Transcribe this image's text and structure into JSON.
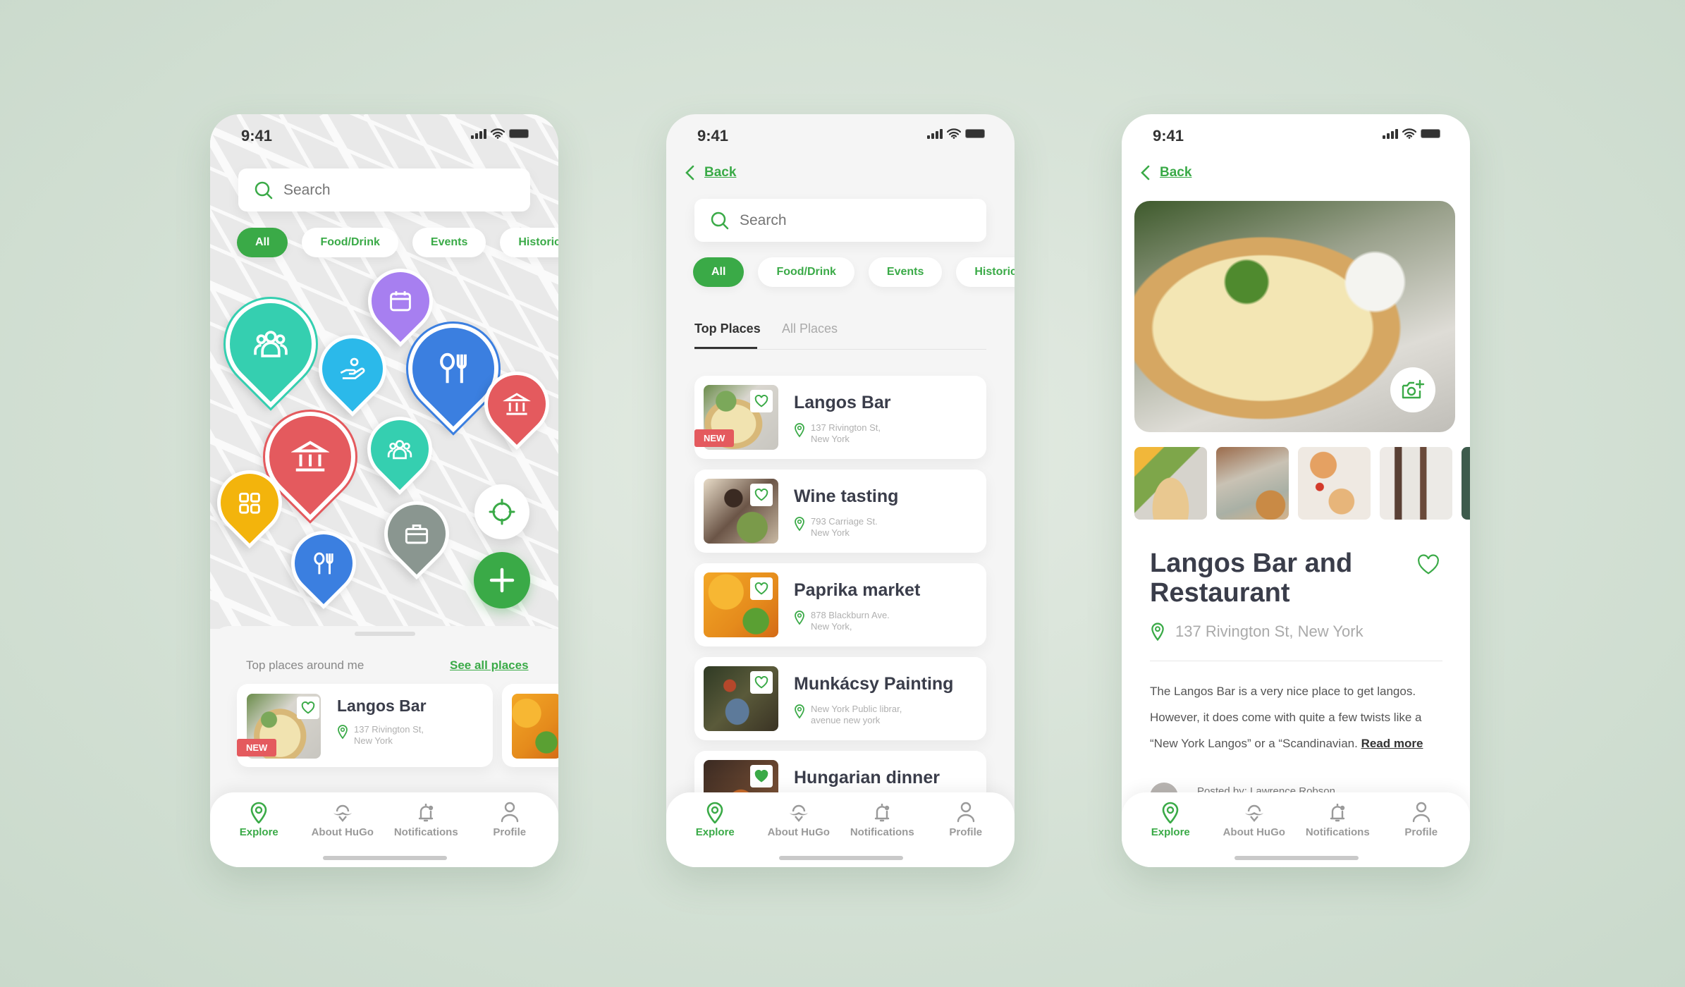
{
  "status": {
    "time": "9:41"
  },
  "search": {
    "placeholder": "Search"
  },
  "filters": [
    "All",
    "Food/Drink",
    "Events",
    "Historic"
  ],
  "colors": {
    "accent": "#3aaa47",
    "new_badge": "#e45a5e",
    "text": "#3a3d4a"
  },
  "map": {
    "pins": [
      {
        "category": "events",
        "icon": "calendar-icon",
        "color": "#a77ff0"
      },
      {
        "category": "community",
        "icon": "group-icon",
        "color": "#35cfb0",
        "selected": true
      },
      {
        "category": "services",
        "icon": "hand-icon",
        "color": "#2bb9ea"
      },
      {
        "category": "food",
        "icon": "fork-knife-icon",
        "color": "#3b7fe0",
        "selected": true
      },
      {
        "category": "historic",
        "icon": "museum-icon",
        "color": "#e45a5e"
      },
      {
        "category": "historic",
        "icon": "museum-icon",
        "color": "#e45a5e",
        "selected": true
      },
      {
        "category": "community",
        "icon": "group-icon",
        "color": "#35cfb0"
      },
      {
        "category": "other",
        "icon": "grid-icon",
        "color": "#f3b40c"
      },
      {
        "category": "work",
        "icon": "briefcase-icon",
        "color": "#8a9690"
      },
      {
        "category": "food",
        "icon": "fork-knife-icon",
        "color": "#3b7fe0"
      }
    ],
    "locate_icon": "crosshair-icon",
    "add_icon": "plus-icon"
  },
  "sheet": {
    "title": "Top places around me",
    "link": "See all places"
  },
  "places": [
    {
      "name": "Langos Bar",
      "addr1": "137 Rivington St,",
      "addr2": "New York",
      "badge": "NEW"
    },
    {
      "name": "Wine tasting",
      "addr1": "793 Carriage St.",
      "addr2": "New York"
    },
    {
      "name": "Paprika market",
      "addr1": "878 Blackburn Ave.",
      "addr2": "New York,"
    },
    {
      "name": "Munkácsy Painting",
      "addr1": "New York Public librar,",
      "addr2": "avenue new york"
    },
    {
      "name": "Hungarian dinner"
    }
  ],
  "list": {
    "back": "Back",
    "tabs": [
      "Top Places",
      "All Places"
    ],
    "active_tab": 0
  },
  "detail": {
    "back": "Back",
    "title": "Langos Bar and Restaurant",
    "address": "137 Rivington St, New York",
    "description": "The Langos Bar is a very nice place to get langos. However, it does come with quite a few twists like a “New York Langos” or a “Scandinavian.",
    "read_more": "Read more",
    "posted_by": "Posted by: Lawrence Robson"
  },
  "nav": [
    {
      "label": "Explore",
      "icon": "map-pin-icon",
      "active": true
    },
    {
      "label": "About HuGo",
      "icon": "mustache-icon"
    },
    {
      "label": "Notifications",
      "icon": "bell-icon"
    },
    {
      "label": "Profile",
      "icon": "user-icon"
    }
  ]
}
